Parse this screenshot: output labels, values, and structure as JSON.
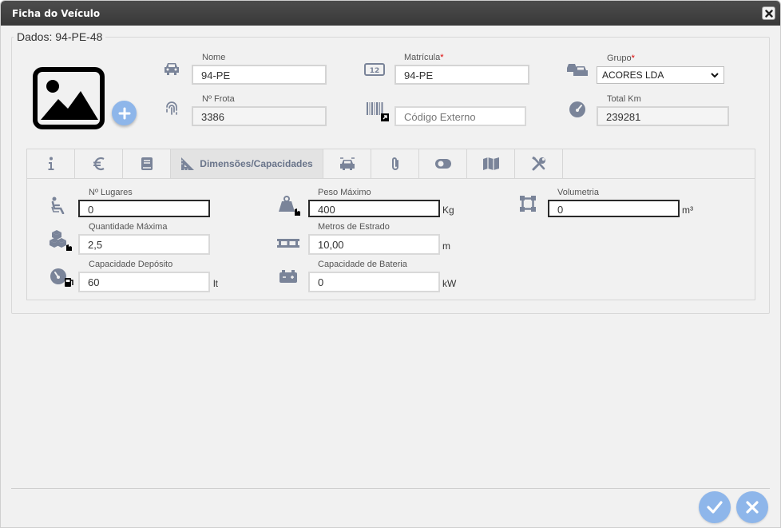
{
  "window": {
    "title": "Ficha do Veículo"
  },
  "legend": "Dados: 94-PE-48",
  "fields": {
    "nome": {
      "label": "Nome",
      "value": "94-PE"
    },
    "matricula": {
      "label": "Matrícula",
      "required": "*",
      "value": "94-PE"
    },
    "grupo": {
      "label": "Grupo",
      "required": "*",
      "value": "ACORES LDA"
    },
    "frota": {
      "label": "Nº Frota",
      "value": "3386"
    },
    "codigo": {
      "placeholder": "Código Externo"
    },
    "totalkm": {
      "label": "Total Km",
      "value": "239281"
    }
  },
  "tabs": {
    "active_label": "Dimensões/Capacidades"
  },
  "dims": {
    "lugares": {
      "label": "Nº Lugares",
      "value": "0"
    },
    "peso": {
      "label": "Peso Máximo",
      "value": "400",
      "unit": "Kg"
    },
    "volumetria": {
      "label": "Volumetria",
      "value": "0",
      "unit": "m³"
    },
    "quantidade": {
      "label": "Quantidade Máxima",
      "value": "2,5"
    },
    "estrado": {
      "label": "Metros de Estrado",
      "value": "10,00",
      "unit": "m"
    },
    "deposito": {
      "label": "Capacidade Depósito",
      "value": "60",
      "unit": "lt"
    },
    "bateria": {
      "label": "Capacidade de Bateria",
      "value": "0",
      "unit": "kW"
    }
  },
  "colors": {
    "accent": "#8eb6ea",
    "icon": "#7a8499",
    "titlebar": "#3f3f3f"
  }
}
